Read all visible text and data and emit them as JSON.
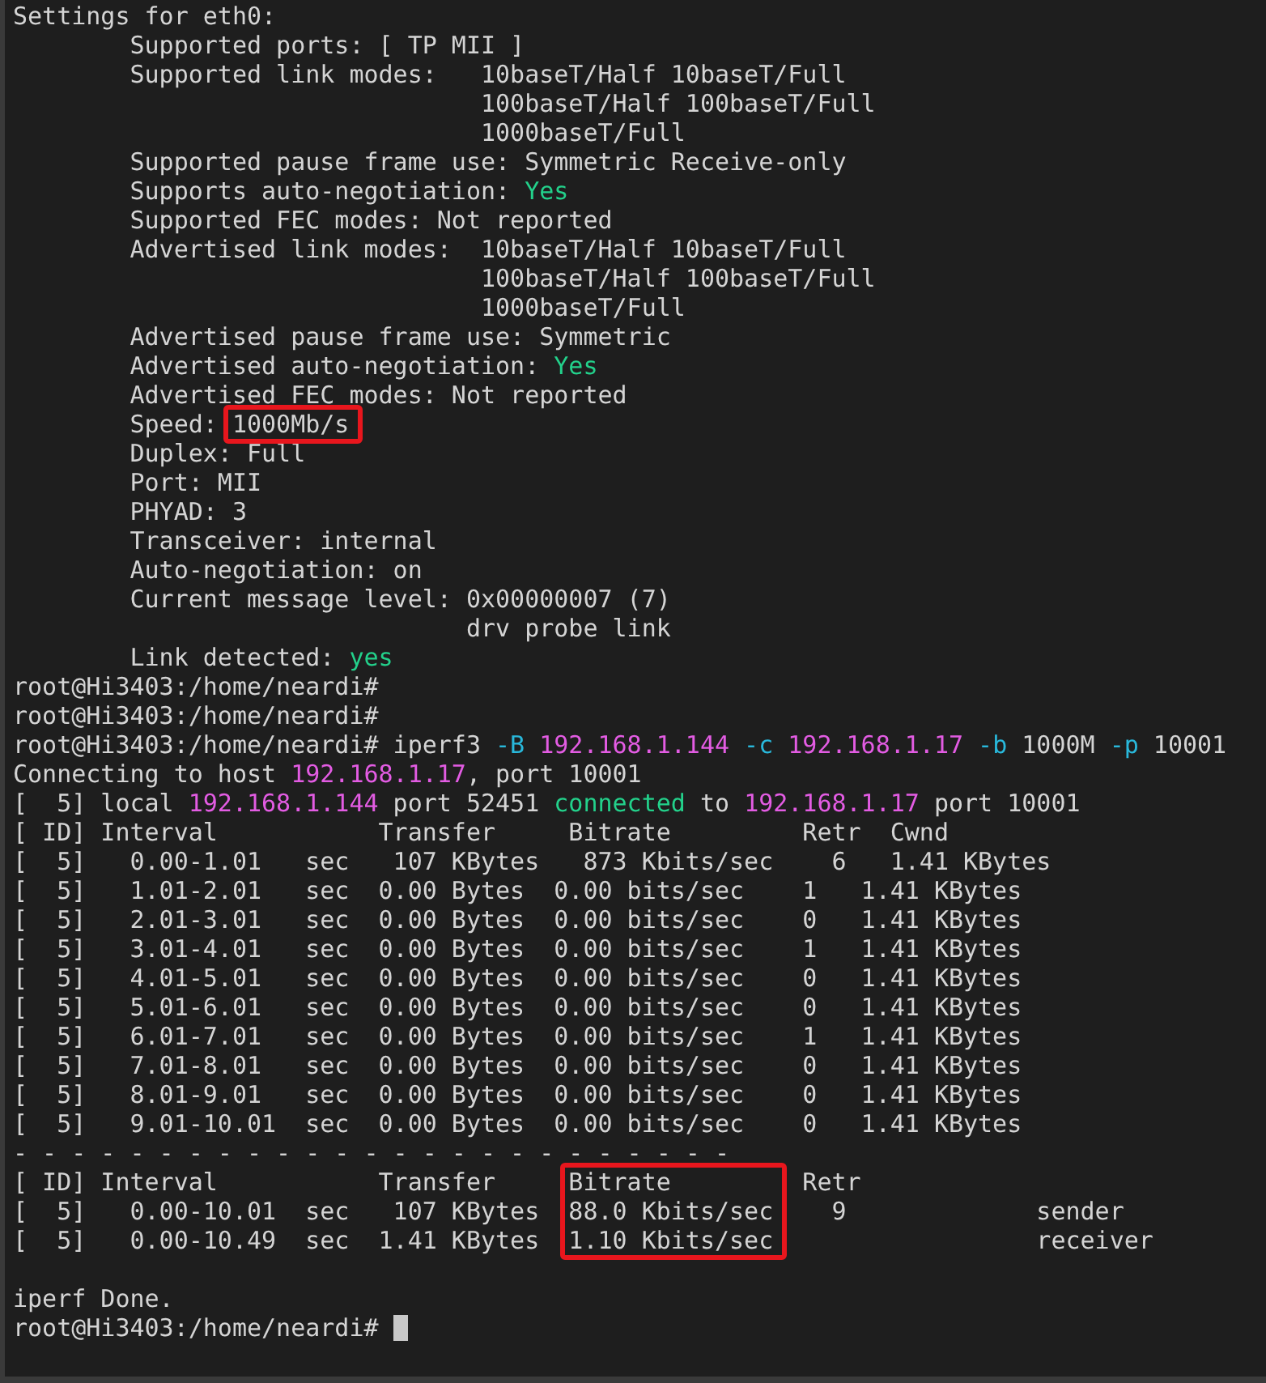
{
  "terminal": {
    "lines": [
      {
        "kind": "text",
        "segments": [
          {
            "kind": "plain",
            "text": "Settings for eth0:"
          }
        ]
      },
      {
        "kind": "text",
        "segments": [
          {
            "kind": "plain",
            "text": "        Supported ports: [ TP MII ]"
          }
        ]
      },
      {
        "kind": "text",
        "segments": [
          {
            "kind": "plain",
            "text": "        Supported link modes:   10baseT/Half 10baseT/Full"
          }
        ]
      },
      {
        "kind": "text",
        "segments": [
          {
            "kind": "plain",
            "text": "                                100baseT/Half 100baseT/Full"
          }
        ]
      },
      {
        "kind": "text",
        "segments": [
          {
            "kind": "plain",
            "text": "                                1000baseT/Full"
          }
        ]
      },
      {
        "kind": "text",
        "segments": [
          {
            "kind": "plain",
            "text": "        Supported pause frame use: Symmetric Receive-only"
          }
        ]
      },
      {
        "kind": "text",
        "segments": [
          {
            "kind": "plain",
            "text": "        Supports auto-negotiation: "
          },
          {
            "kind": "ok",
            "text": "Yes"
          }
        ]
      },
      {
        "kind": "text",
        "segments": [
          {
            "kind": "plain",
            "text": "        Supported FEC modes: Not reported"
          }
        ]
      },
      {
        "kind": "text",
        "segments": [
          {
            "kind": "plain",
            "text": "        Advertised link modes:  10baseT/Half 10baseT/Full"
          }
        ]
      },
      {
        "kind": "text",
        "segments": [
          {
            "kind": "plain",
            "text": "                                100baseT/Half 100baseT/Full"
          }
        ]
      },
      {
        "kind": "text",
        "segments": [
          {
            "kind": "plain",
            "text": "                                1000baseT/Full"
          }
        ]
      },
      {
        "kind": "text",
        "segments": [
          {
            "kind": "plain",
            "text": "        Advertised pause frame use: Symmetric"
          }
        ]
      },
      {
        "kind": "text",
        "segments": [
          {
            "kind": "plain",
            "text": "        Advertised auto-negotiation: "
          },
          {
            "kind": "ok",
            "text": "Yes"
          }
        ]
      },
      {
        "kind": "text",
        "segments": [
          {
            "kind": "plain",
            "text": "        Advertised FEC modes: Not reported"
          }
        ]
      },
      {
        "kind": "text",
        "segments": [
          {
            "kind": "plain",
            "text": "        Speed: "
          },
          {
            "kind": "plain",
            "text": "1000Mb/s",
            "boxed": true
          }
        ]
      },
      {
        "kind": "text",
        "segments": [
          {
            "kind": "plain",
            "text": "        Duplex: Full"
          }
        ]
      },
      {
        "kind": "text",
        "segments": [
          {
            "kind": "plain",
            "text": "        Port: MII"
          }
        ]
      },
      {
        "kind": "text",
        "segments": [
          {
            "kind": "plain",
            "text": "        PHYAD: 3"
          }
        ]
      },
      {
        "kind": "text",
        "segments": [
          {
            "kind": "plain",
            "text": "        Transceiver: internal"
          }
        ]
      },
      {
        "kind": "text",
        "segments": [
          {
            "kind": "plain",
            "text": "        Auto-negotiation: on"
          }
        ]
      },
      {
        "kind": "text",
        "segments": [
          {
            "kind": "plain",
            "text": "        Current message level: 0x00000007 (7)"
          }
        ]
      },
      {
        "kind": "text",
        "segments": [
          {
            "kind": "plain",
            "text": "                               drv probe link"
          }
        ]
      },
      {
        "kind": "text",
        "segments": [
          {
            "kind": "plain",
            "text": "        Link detected: "
          },
          {
            "kind": "ok",
            "text": "yes"
          }
        ]
      },
      {
        "kind": "text",
        "segments": [
          {
            "kind": "plain",
            "text": "root@Hi3403:/home/neardi#"
          }
        ]
      },
      {
        "kind": "text",
        "segments": [
          {
            "kind": "plain",
            "text": "root@Hi3403:/home/neardi#"
          }
        ]
      },
      {
        "kind": "text",
        "segments": [
          {
            "kind": "plain",
            "text": "root@Hi3403:/home/neardi# iperf3 "
          },
          {
            "kind": "flag",
            "text": "-B "
          },
          {
            "kind": "address",
            "text": "192.168.1.144 "
          },
          {
            "kind": "flag",
            "text": "-c "
          },
          {
            "kind": "address",
            "text": "192.168.1.17 "
          },
          {
            "kind": "flag",
            "text": "-b"
          },
          {
            "kind": "plain",
            "text": " 1000M "
          },
          {
            "kind": "flag",
            "text": "-p"
          },
          {
            "kind": "plain",
            "text": " 10001"
          }
        ]
      },
      {
        "kind": "text",
        "segments": [
          {
            "kind": "plain",
            "text": "Connecting to host "
          },
          {
            "kind": "address",
            "text": "192.168.1.17"
          },
          {
            "kind": "plain",
            "text": ", port 10001"
          }
        ]
      },
      {
        "kind": "text",
        "segments": [
          {
            "kind": "plain",
            "text": "[  5] local "
          },
          {
            "kind": "address",
            "text": "192.168.1.144"
          },
          {
            "kind": "plain",
            "text": " port 52451 "
          },
          {
            "kind": "ok",
            "text": "connected"
          },
          {
            "kind": "plain",
            "text": " to "
          },
          {
            "kind": "address",
            "text": "192.168.1.17"
          },
          {
            "kind": "plain",
            "text": " port 10001"
          }
        ]
      },
      {
        "kind": "text",
        "segments": [
          {
            "kind": "plain",
            "text": "[ ID] Interval           Transfer     Bitrate         Retr  Cwnd"
          }
        ]
      },
      {
        "kind": "text",
        "segments": [
          {
            "kind": "plain",
            "text": "[  5]   0.00-1.01   sec   107 KBytes   873 Kbits/sec    6   1.41 KBytes"
          }
        ]
      },
      {
        "kind": "text",
        "segments": [
          {
            "kind": "plain",
            "text": "[  5]   1.01-2.01   sec  0.00 Bytes  0.00 bits/sec    1   1.41 KBytes"
          }
        ]
      },
      {
        "kind": "text",
        "segments": [
          {
            "kind": "plain",
            "text": "[  5]   2.01-3.01   sec  0.00 Bytes  0.00 bits/sec    0   1.41 KBytes"
          }
        ]
      },
      {
        "kind": "text",
        "segments": [
          {
            "kind": "plain",
            "text": "[  5]   3.01-4.01   sec  0.00 Bytes  0.00 bits/sec    1   1.41 KBytes"
          }
        ]
      },
      {
        "kind": "text",
        "segments": [
          {
            "kind": "plain",
            "text": "[  5]   4.01-5.01   sec  0.00 Bytes  0.00 bits/sec    0   1.41 KBytes"
          }
        ]
      },
      {
        "kind": "text",
        "segments": [
          {
            "kind": "plain",
            "text": "[  5]   5.01-6.01   sec  0.00 Bytes  0.00 bits/sec    0   1.41 KBytes"
          }
        ]
      },
      {
        "kind": "text",
        "segments": [
          {
            "kind": "plain",
            "text": "[  5]   6.01-7.01   sec  0.00 Bytes  0.00 bits/sec    1   1.41 KBytes"
          }
        ]
      },
      {
        "kind": "text",
        "segments": [
          {
            "kind": "plain",
            "text": "[  5]   7.01-8.01   sec  0.00 Bytes  0.00 bits/sec    0   1.41 KBytes"
          }
        ]
      },
      {
        "kind": "text",
        "segments": [
          {
            "kind": "plain",
            "text": "[  5]   8.01-9.01   sec  0.00 Bytes  0.00 bits/sec    0   1.41 KBytes"
          }
        ]
      },
      {
        "kind": "text",
        "segments": [
          {
            "kind": "plain",
            "text": "[  5]   9.01-10.01  sec  0.00 Bytes  0.00 bits/sec    0   1.41 KBytes"
          }
        ]
      },
      {
        "kind": "text",
        "segments": [
          {
            "kind": "plain",
            "text": "- - - - - - - - - - - - - - - - - - - - - - - - -"
          }
        ]
      },
      {
        "kind": "text",
        "segments": [
          {
            "kind": "plain",
            "text": "[ ID] Interval           Transfer     "
          },
          {
            "kind": "plain",
            "text": "Bitrate",
            "boxed": true
          },
          {
            "kind": "plain",
            "text": "         Retr"
          }
        ]
      },
      {
        "kind": "text",
        "segments": [
          {
            "kind": "plain",
            "text": "[  5]   0.00-10.01  sec   107 KBytes  "
          },
          {
            "kind": "plain",
            "text": "88.0 Kbits/sec",
            "boxed": true
          },
          {
            "kind": "plain",
            "text": "    9             sender"
          }
        ]
      },
      {
        "kind": "text",
        "segments": [
          {
            "kind": "plain",
            "text": "[  5]   0.00-10.49  sec  1.41 KBytes  "
          },
          {
            "kind": "plain",
            "text": "1.10 Kbits/sec",
            "boxed": true
          },
          {
            "kind": "plain",
            "text": "                  receiver"
          }
        ]
      },
      {
        "kind": "blank"
      },
      {
        "kind": "text",
        "segments": [
          {
            "kind": "plain",
            "text": "iperf Done."
          }
        ]
      },
      {
        "kind": "text",
        "cursor": true,
        "segments": [
          {
            "kind": "plain",
            "text": "root@Hi3403:/home/neardi# "
          }
        ]
      }
    ]
  }
}
